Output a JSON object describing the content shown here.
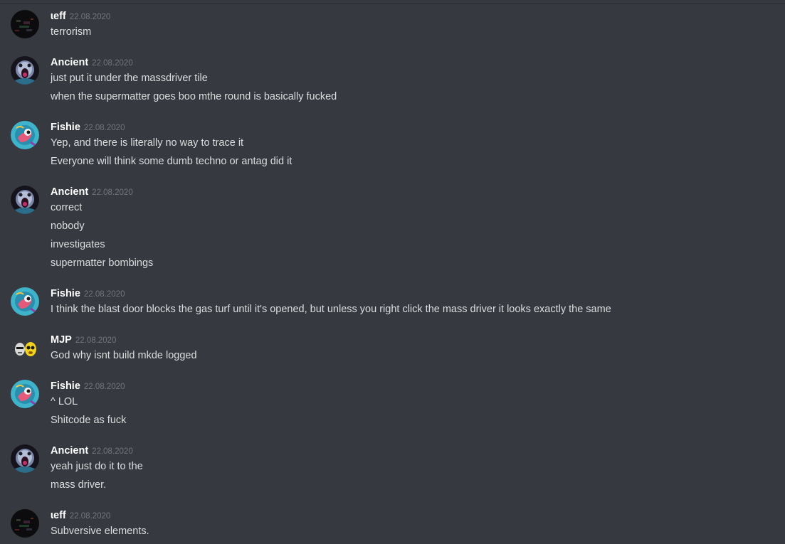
{
  "channel": {
    "messages": [
      {
        "author": "ɩeff",
        "timestamp": "22.08.2020",
        "avatar": "dark-pixel-avatar",
        "lines": [
          "terrorism"
        ]
      },
      {
        "author": "Ancient",
        "timestamp": "22.08.2020",
        "avatar": "screaming-ghoul-avatar",
        "lines": [
          "just put it under the massdriver tile",
          "when the supermatter goes boo mthe round is basically fucked"
        ]
      },
      {
        "author": "Fishie",
        "timestamp": "22.08.2020",
        "avatar": "teal-fish-avatar",
        "lines": [
          "Yep, and there is literally no way to trace it",
          "Everyone will think some dumb techno or antag did it"
        ]
      },
      {
        "author": "Ancient",
        "timestamp": "22.08.2020",
        "avatar": "screaming-ghoul-avatar",
        "lines": [
          "correct",
          "nobody",
          "investigates",
          "supermatter bombings"
        ]
      },
      {
        "author": "Fishie",
        "timestamp": "22.08.2020",
        "avatar": "teal-fish-avatar",
        "lines": [
          "I think the blast door blocks the gas turf until it's opened, but unless you right click the mass driver it looks exactly the same"
        ]
      },
      {
        "author": "MJP",
        "timestamp": "22.08.2020",
        "avatar": "two-faces-avatar",
        "lines": [
          "God why isnt build mkde logged"
        ]
      },
      {
        "author": "Fishie",
        "timestamp": "22.08.2020",
        "avatar": "teal-fish-avatar",
        "lines": [
          "^ LOL",
          "Shitcode as fuck"
        ]
      },
      {
        "author": "Ancient",
        "timestamp": "22.08.2020",
        "avatar": "screaming-ghoul-avatar",
        "lines": [
          "yeah just do it to the",
          "mass driver."
        ]
      },
      {
        "author": "ɩeff",
        "timestamp": "22.08.2020",
        "avatar": "dark-pixel-avatar",
        "lines": [
          "Subversive elements."
        ]
      }
    ]
  },
  "colors": {
    "background": "#36393f",
    "author": "#ffffff",
    "timestamp": "#72767d",
    "text": "#dcddde"
  }
}
